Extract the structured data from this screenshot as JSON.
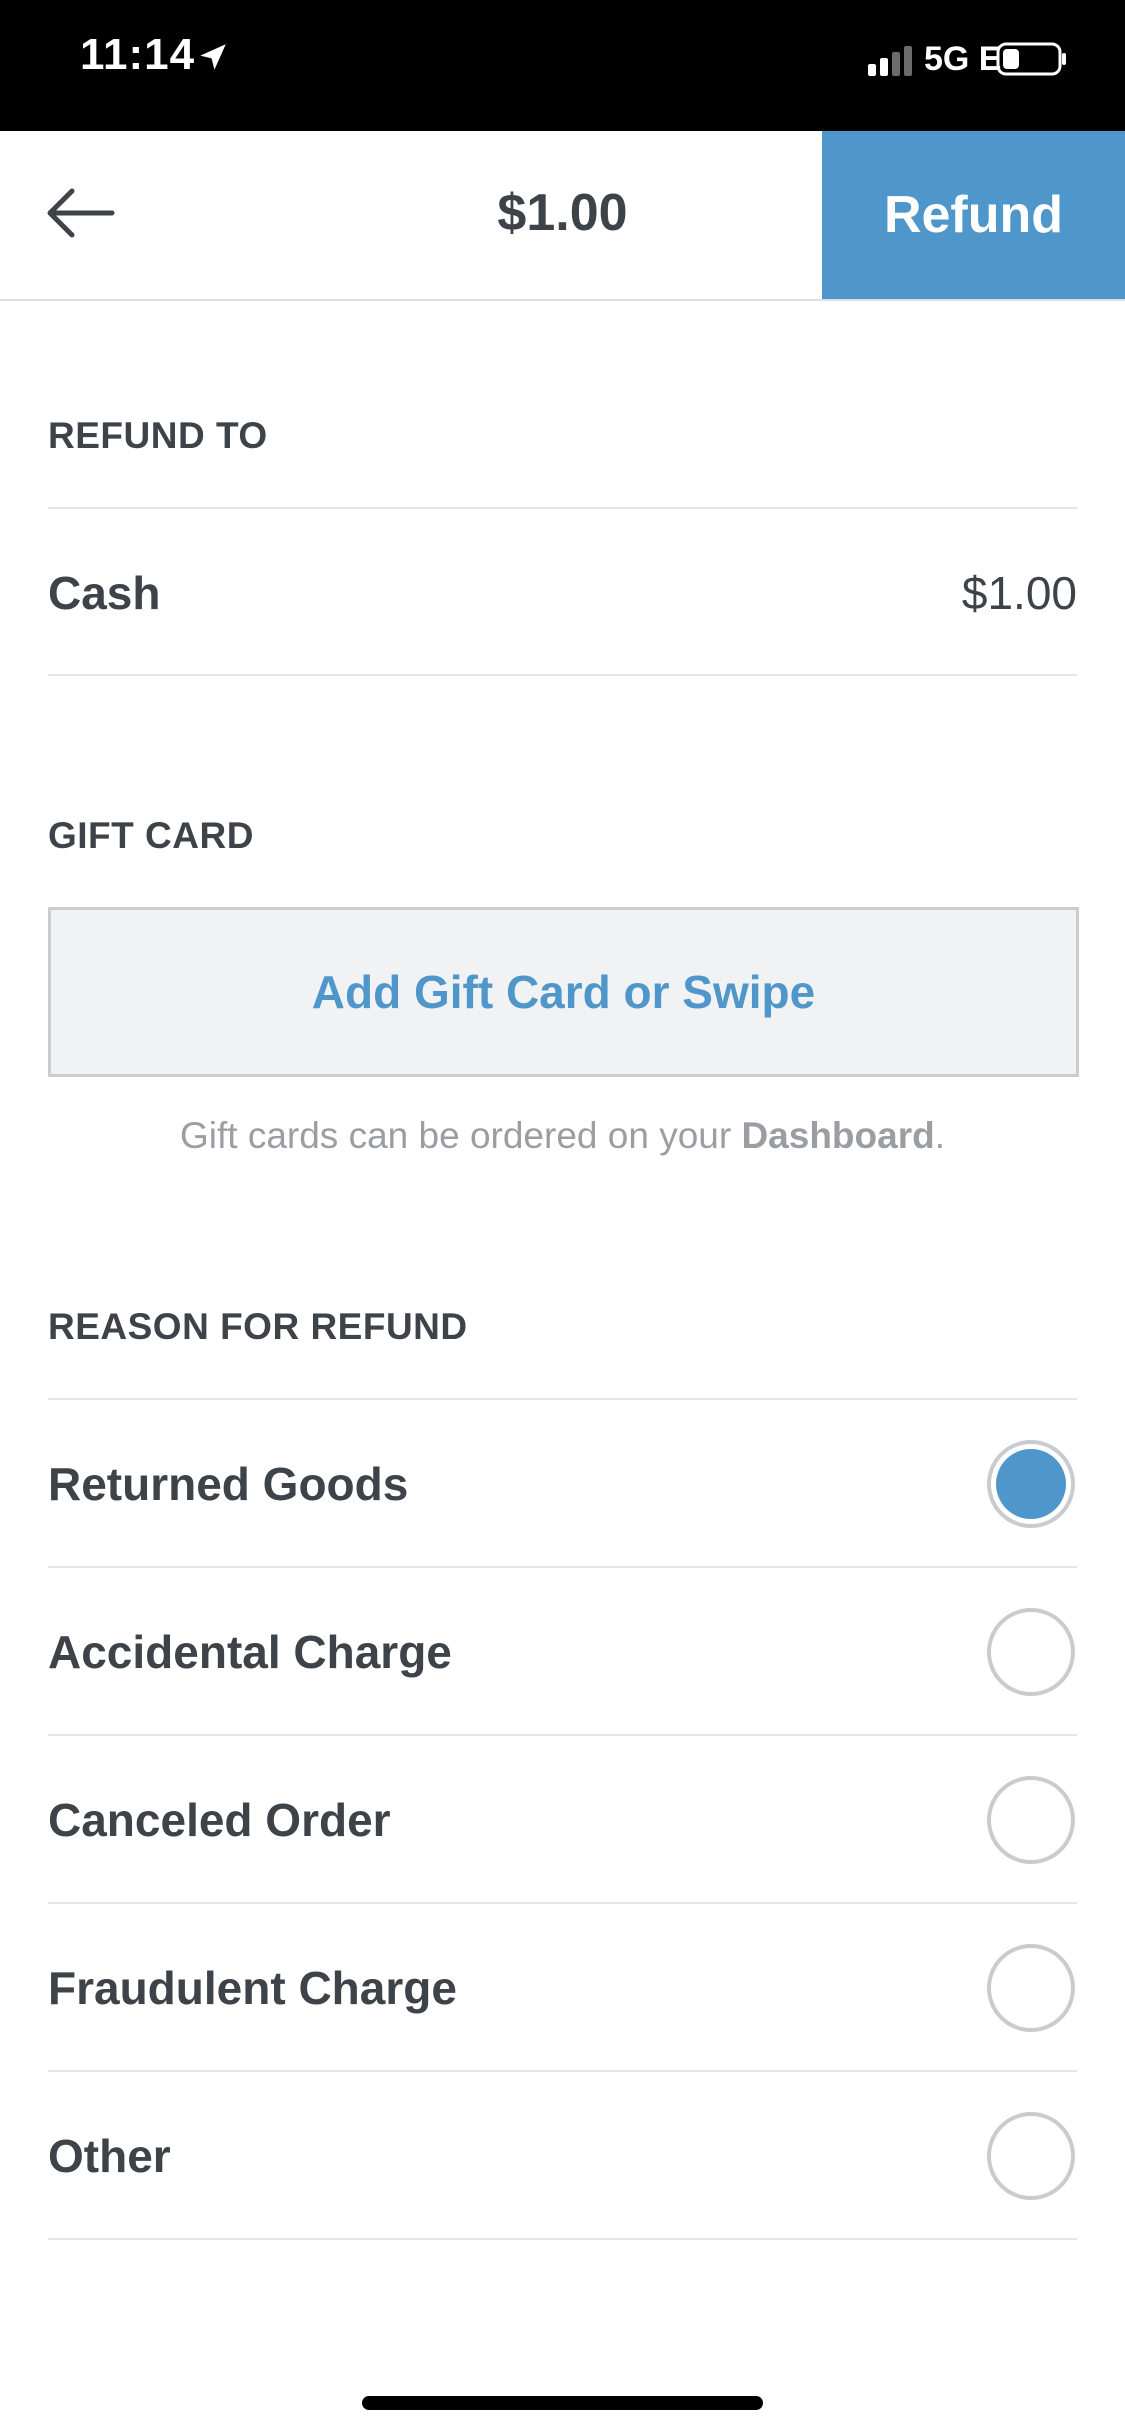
{
  "status_bar": {
    "time": "11:14",
    "network": "5G E"
  },
  "nav": {
    "title": "$1.00",
    "refund_label": "Refund"
  },
  "refund_to": {
    "header": "REFUND TO",
    "method_label": "Cash",
    "amount": "$1.00"
  },
  "gift_card": {
    "header": "GIFT CARD",
    "button_label": "Add Gift Card or Swipe",
    "note_prefix": "Gift cards can be ordered on your ",
    "note_link": "Dashboard",
    "note_suffix": "."
  },
  "reason": {
    "header": "REASON FOR REFUND",
    "options": [
      {
        "label": "Returned Goods",
        "selected": true
      },
      {
        "label": "Accidental Charge",
        "selected": false
      },
      {
        "label": "Canceled Order",
        "selected": false
      },
      {
        "label": "Fraudulent Charge",
        "selected": false
      },
      {
        "label": "Other",
        "selected": false
      }
    ]
  },
  "colors": {
    "accent": "#4f96cb",
    "text": "#3d4349",
    "muted": "#9a9ea3",
    "divider": "#e3e5e8"
  }
}
